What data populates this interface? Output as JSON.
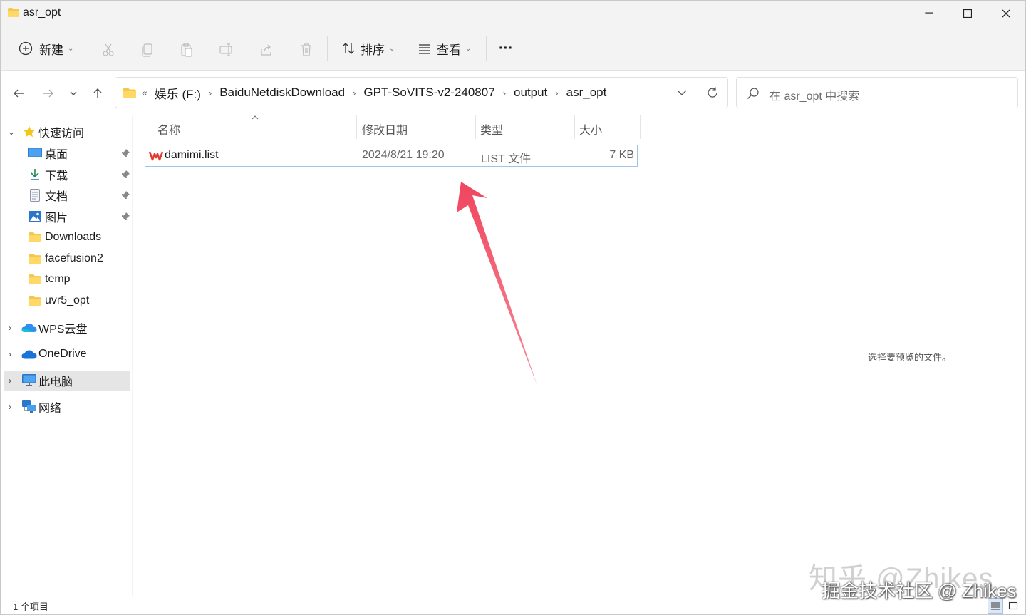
{
  "window": {
    "title": "asr_opt",
    "controls": {
      "minimize": "─",
      "maximize": "☐",
      "close": "✕"
    }
  },
  "toolbar": {
    "new_label": "新建",
    "sort_label": "排序",
    "view_label": "查看",
    "more_label": "···"
  },
  "address": {
    "overflow": "«",
    "crumbs": [
      "娱乐 (F:)",
      "BaiduNetdiskDownload",
      "GPT-SoVITS-v2-240807",
      "output",
      "asr_opt"
    ]
  },
  "search": {
    "placeholder": "在 asr_opt 中搜索"
  },
  "sidebar": {
    "quick_access": "快速访问",
    "quick_items": [
      {
        "label": "桌面",
        "icon": "desktop-icon",
        "pinned": true
      },
      {
        "label": "下载",
        "icon": "download-icon",
        "pinned": true
      },
      {
        "label": "文档",
        "icon": "document-icon",
        "pinned": true
      },
      {
        "label": "图片",
        "icon": "pictures-icon",
        "pinned": true
      },
      {
        "label": "Downloads",
        "icon": "folder-icon",
        "pinned": false
      },
      {
        "label": "facefusion2",
        "icon": "folder-icon",
        "pinned": false
      },
      {
        "label": "temp",
        "icon": "folder-icon",
        "pinned": false
      },
      {
        "label": "uvr5_opt",
        "icon": "folder-icon",
        "pinned": false
      }
    ],
    "wps_cloud": "WPS云盘",
    "onedrive": "OneDrive",
    "this_pc": "此电脑",
    "network": "网络"
  },
  "columns": {
    "name": "名称",
    "date": "修改日期",
    "type": "类型",
    "size": "大小"
  },
  "files": [
    {
      "name": "damimi.list",
      "date": "2024/8/21 19:20",
      "type": "LIST 文件",
      "size": "7 KB"
    }
  ],
  "preview": {
    "message": "选择要预览的文件。"
  },
  "status": {
    "item_count": "1 个项目"
  },
  "watermark": {
    "line1": "知乎 @Zhikes",
    "line2": "掘金技术社区 @ Zhikes"
  },
  "colors": {
    "accent": "#0067c0",
    "folder": "#f4c84a",
    "arrow": "#f0455e",
    "selection_border": "#9fc4e9"
  }
}
